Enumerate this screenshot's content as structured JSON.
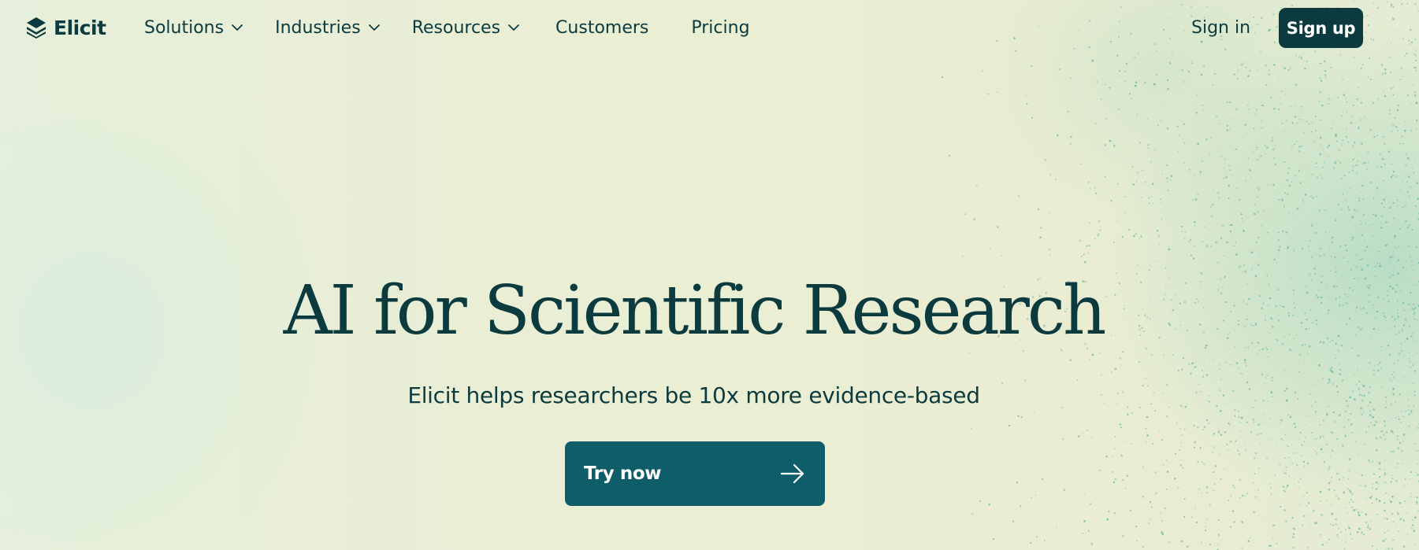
{
  "brand": {
    "name": "Elicit",
    "logo_icon": "elicit-stack-logo-icon"
  },
  "nav": {
    "items": [
      {
        "label": "Solutions",
        "has_dropdown": true,
        "icon": "chevron-down-icon"
      },
      {
        "label": "Industries",
        "has_dropdown": true,
        "icon": "chevron-down-icon"
      },
      {
        "label": "Resources",
        "has_dropdown": true,
        "icon": "chevron-down-icon"
      },
      {
        "label": "Customers",
        "has_dropdown": false
      },
      {
        "label": "Pricing",
        "has_dropdown": false
      }
    ],
    "sign_in_label": "Sign in",
    "sign_up_label": "Sign up"
  },
  "hero": {
    "title": "AI for Scientific Research",
    "subtitle": "Elicit helps researchers be 10x more evidence-based",
    "cta_label": "Try now",
    "cta_icon": "arrow-right-icon"
  },
  "colors": {
    "primary_dark": "#0b3b3f",
    "cta_teal": "#0e5d68",
    "background": "#eaeed3",
    "dot_accent": "#5fb59a"
  }
}
